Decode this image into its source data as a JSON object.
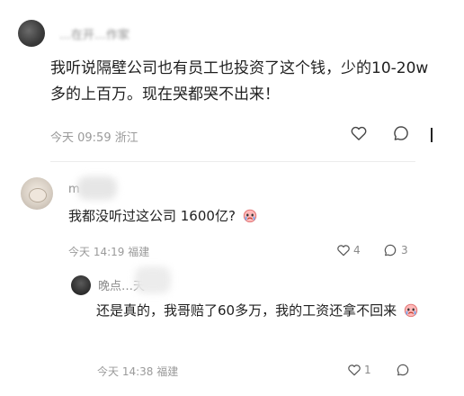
{
  "top_comment": {
    "author": "…在开…作家",
    "body": "我听说隔壁公司也有员工也投资了这个钱，少的10-20w 多的上百万。现在哭都哭不出来！",
    "time": "今天 09:59",
    "location": "浙江"
  },
  "reply_1": {
    "author": "m",
    "body": "我都没听过这公司 1600亿?",
    "time": "今天 14:19",
    "location": "福建",
    "like_count": "4",
    "reply_count": "3"
  },
  "reply_2": {
    "author": "晚点…天",
    "body": "还是真的，我哥赔了60多万，我的工资还拿不回来",
    "time": "今天 14:38",
    "location": "福建",
    "like_count": "1"
  },
  "icons": {
    "like": "heart-outline-icon",
    "comment": "speech-bubble-icon",
    "emoji": "crying-face-emoji"
  },
  "colors": {
    "meta": "#9a9a9a",
    "body": "#1f1f1f",
    "divider": "#ececec"
  }
}
